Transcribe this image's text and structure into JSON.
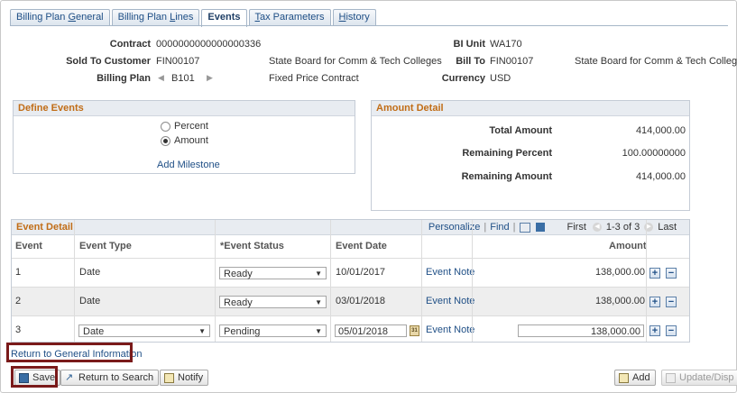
{
  "tabs": [
    {
      "label": "Billing Plan General",
      "u": "G",
      "pre": "Billing Plan ",
      "post": "eneral"
    },
    {
      "label": "Billing Plan Lines",
      "pre": "Billing Plan ",
      "u": "L",
      "post": "ines"
    },
    {
      "label": "Events"
    },
    {
      "label": "Tax Parameters",
      "u": "T",
      "pre": "",
      "post": "ax Parameters"
    },
    {
      "label": "History",
      "u": "H",
      "pre": "",
      "post": "istory"
    }
  ],
  "header": {
    "contract_label": "Contract",
    "contract_value": "0000000000000000336",
    "bi_unit_label": "BI Unit",
    "bi_unit_value": "WA170",
    "sold_to_label": "Sold To Customer",
    "sold_to_value": "FIN00107",
    "sold_to_name": "State Board for Comm & Tech Colleges",
    "bill_to_label": "Bill To",
    "bill_to_value": "FIN00107",
    "bill_to_name": "State Board for Comm & Tech Colleges",
    "billing_plan_label": "Billing Plan",
    "billing_plan_value": "B101",
    "billing_plan_desc": "Fixed Price Contract",
    "currency_label": "Currency",
    "currency_value": "USD"
  },
  "define_events": {
    "title": "Define Events",
    "percent_label": "Percent",
    "amount_label": "Amount",
    "selected": "Amount",
    "add_milestone": "Add Milestone"
  },
  "amount_detail": {
    "title": "Amount Detail",
    "total_label": "Total Amount",
    "total_value": "414,000.00",
    "remaining_percent_label": "Remaining Percent",
    "remaining_percent_value": "100.00000000",
    "remaining_amount_label": "Remaining Amount",
    "remaining_amount_value": "414,000.00"
  },
  "event_detail": {
    "title": "Event Detail",
    "personalize": "Personalize",
    "find": "Find",
    "first": "First",
    "range": "1-3 of 3",
    "last": "Last",
    "columns": {
      "event": "Event",
      "event_type": "Event Type",
      "event_status": "*Event Status",
      "event_date": "Event Date",
      "amount": "Amount"
    },
    "rows": [
      {
        "event": "1",
        "type": "Date",
        "status": "Ready",
        "date": "10/01/2017",
        "note": "Event Note",
        "amount": "138,000.00"
      },
      {
        "event": "2",
        "type": "Date",
        "status": "Ready",
        "date": "03/01/2018",
        "note": "Event Note",
        "amount": "138,000.00"
      },
      {
        "event": "3",
        "type": "Date",
        "status": "Pending",
        "date": "05/01/2018",
        "note": "Event Note",
        "amount": "138,000.00"
      }
    ]
  },
  "footer": {
    "return_link": "Return to General Information",
    "save": "Save",
    "return_search": "Return to Search",
    "notify": "Notify",
    "add": "Add",
    "update": "Update/Disp"
  },
  "colors": {
    "accent_orange": "#c16d17",
    "link_blue": "#1f4f86",
    "highlight": "#7a1a1a"
  }
}
